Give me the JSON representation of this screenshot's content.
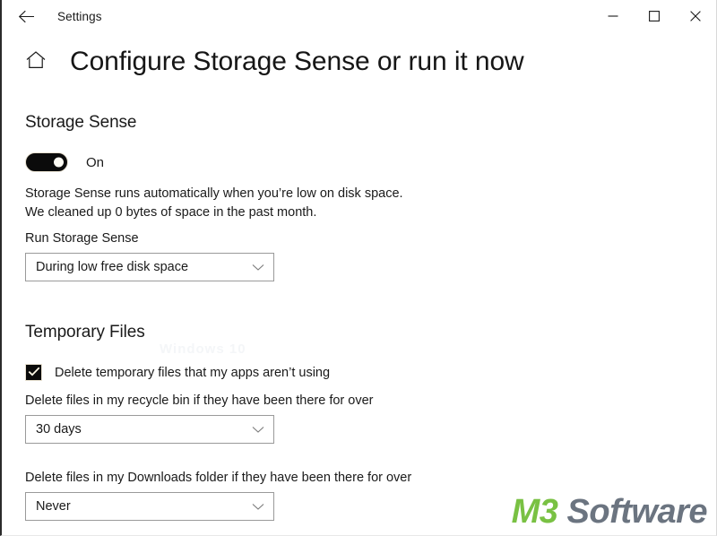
{
  "window": {
    "app_title": "Settings",
    "back_icon": "arrow-left-icon",
    "controls": {
      "minimize": "minimize-icon",
      "maximize": "maximize-icon",
      "close": "close-icon"
    }
  },
  "header": {
    "home_icon": "home-icon",
    "title": "Configure Storage Sense or run it now"
  },
  "storage_sense": {
    "heading": "Storage Sense",
    "toggle": {
      "state": "On",
      "label": "On",
      "checked": true,
      "color": "#0b0b0b"
    },
    "description_line1": "Storage Sense runs automatically when you’re low on disk space.",
    "description_line2": "We cleaned up 0 bytes of space in the past month.",
    "run_label": "Run Storage Sense",
    "run_value": "During low free disk space",
    "chevron_icon": "chevron-down-icon"
  },
  "temporary_files": {
    "heading": "Temporary Files",
    "delete_temp_checkbox": {
      "label": "Delete temporary files that my apps aren’t using",
      "checked": true,
      "check_icon": "checkmark-icon"
    },
    "recycle_bin_label": "Delete files in my recycle bin if they have been there for over",
    "recycle_bin_value": "30 days",
    "downloads_label": "Delete files in my Downloads folder if they have been there for over",
    "downloads_value": "Never",
    "chevron_icon": "chevron-down-icon"
  },
  "artifacts": {
    "ghost_text": "Windows 10"
  },
  "watermark": {
    "brand_primary": "M3",
    "brand_secondary": "Software",
    "primary_color": "#79c143",
    "secondary_color": "#6b7480"
  }
}
